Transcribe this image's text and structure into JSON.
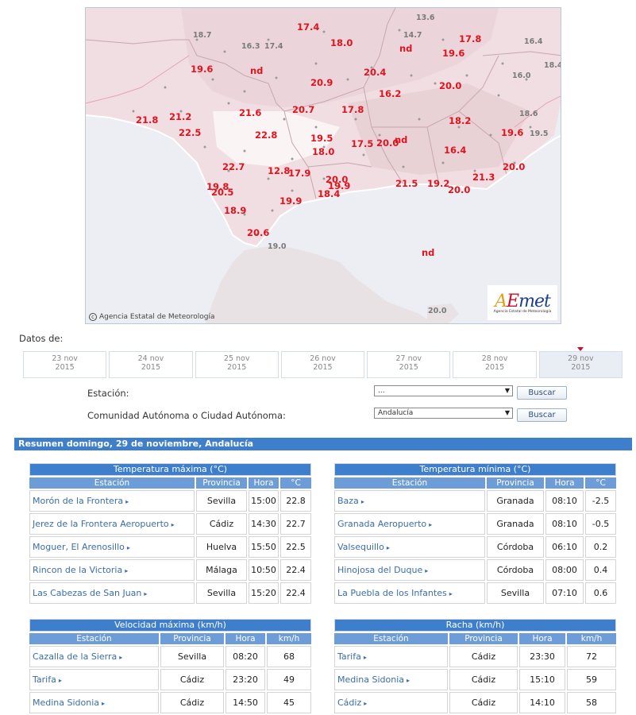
{
  "map": {
    "credit": "Agencia Estatal de Meteorología",
    "logo_text": "AEmet",
    "logo_sub": "Agencia Estatal de Meteorología",
    "values_red": [
      "17.4",
      "18.0",
      "17.8",
      "19.6",
      "nd",
      "19.6",
      "20.9",
      "20.4",
      "16.2",
      "20.0",
      "21.8",
      "21.2",
      "21.6",
      "20.7",
      "17.8",
      "18.2",
      "22.5",
      "22.8",
      "19.5",
      "18.0",
      "17.5",
      "20.0",
      "nd",
      "16.4",
      "19.6",
      "20.0",
      "22.7",
      "12.8",
      "17.9",
      "20.0",
      "19.9",
      "21.5",
      "19.2",
      "21.3",
      "20.0",
      "19.8",
      "20.5",
      "18.4",
      "19.9",
      "18.9",
      "20.6",
      "nd",
      "nd"
    ],
    "values_grey": [
      "13.6",
      "18.7",
      "14.7",
      "16.4",
      "16.3",
      "17.4",
      "18.4",
      "16.0",
      "18.6",
      "19.5",
      "19.0",
      "20.0"
    ]
  },
  "dates": {
    "label": "Datos de:",
    "tabs": [
      {
        "day": "23 nov",
        "year": "2015"
      },
      {
        "day": "24 nov",
        "year": "2015"
      },
      {
        "day": "25 nov",
        "year": "2015"
      },
      {
        "day": "26 nov",
        "year": "2015"
      },
      {
        "day": "27 nov",
        "year": "2015"
      },
      {
        "day": "28 nov",
        "year": "2015"
      },
      {
        "day": "29 nov",
        "year": "2015"
      }
    ]
  },
  "form": {
    "station_label": "Estación:",
    "station_value": "...",
    "community_label": "Comunidad Autónoma o Ciudad Autónoma:",
    "community_value": "Andalucía",
    "search_label": "Buscar"
  },
  "summary": {
    "title": "Resumen domingo, 29 de noviembre, Andalucía"
  },
  "tmax": {
    "title": "Temperatura máxima (°C)",
    "headers": [
      "Estación",
      "Provincia",
      "Hora",
      "°C"
    ],
    "rows": [
      [
        "Morón de la Frontera",
        "Sevilla",
        "15:00",
        "22.8"
      ],
      [
        "Jerez de la Frontera Aeropuerto",
        "Cádiz",
        "14:30",
        "22.7"
      ],
      [
        "Moguer, El Arenosillo",
        "Huelva",
        "15:50",
        "22.5"
      ],
      [
        "Rincon de la Victoria",
        "Málaga",
        "10:50",
        "22.4"
      ],
      [
        "Las Cabezas de San Juan",
        "Sevilla",
        "15:20",
        "22.4"
      ]
    ]
  },
  "tmin": {
    "title": "Temperatura mínima (°C)",
    "headers": [
      "Estación",
      "Provincia",
      "Hora",
      "°C"
    ],
    "rows": [
      [
        "Baza",
        "Granada",
        "08:10",
        "-2.5"
      ],
      [
        "Granada Aeropuerto",
        "Granada",
        "08:10",
        "-0.5"
      ],
      [
        "Valsequillo",
        "Córdoba",
        "06:10",
        "0.2"
      ],
      [
        "Hinojosa del Duque",
        "Córdoba",
        "08:00",
        "0.4"
      ],
      [
        "La Puebla de los Infantes",
        "Sevilla",
        "07:10",
        "0.6"
      ]
    ]
  },
  "vmax": {
    "title": "Velocidad máxima (km/h)",
    "headers": [
      "Estación",
      "Provincia",
      "Hora",
      "km/h"
    ],
    "rows": [
      [
        "Cazalla de la Sierra",
        "Sevilla",
        "08:20",
        "68"
      ],
      [
        "Tarifa",
        "Cádiz",
        "23:20",
        "49"
      ],
      [
        "Medina Sidonia",
        "Cádiz",
        "14:50",
        "45"
      ]
    ]
  },
  "racha": {
    "title": "Racha (km/h)",
    "headers": [
      "Estación",
      "Provincia",
      "Hora",
      "km/h"
    ],
    "rows": [
      [
        "Tarifa",
        "Cádiz",
        "23:30",
        "72"
      ],
      [
        "Medina Sidonia",
        "Cádiz",
        "15:10",
        "59"
      ],
      [
        "Cádiz",
        "Cádiz",
        "14:10",
        "58"
      ]
    ]
  }
}
